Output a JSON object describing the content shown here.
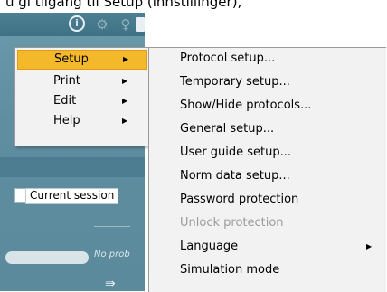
{
  "caption_text": "u gi tilgang til Setup (innstillinger),",
  "toolbar": {
    "info_icon": "info-icon",
    "gear_icon": "gear-icon",
    "bulb_icon": "bulb-icon",
    "exit_icon": "exit-door-icon"
  },
  "session": {
    "label": "Current session"
  },
  "status": {
    "no_prob": "No prob"
  },
  "menu": {
    "items": [
      {
        "label": "Setup",
        "has_submenu": true,
        "highlighted": true
      },
      {
        "label": "Print",
        "has_submenu": true
      },
      {
        "label": "Edit",
        "has_submenu": true
      },
      {
        "label": "Help",
        "has_submenu": true
      }
    ]
  },
  "submenu": {
    "items": [
      {
        "label": "Protocol setup..."
      },
      {
        "label": "Temporary setup..."
      },
      {
        "label": "Show/Hide protocols..."
      },
      {
        "label": "General setup..."
      },
      {
        "label": "User guide setup..."
      },
      {
        "label": "Norm data setup..."
      },
      {
        "label": "Password protection"
      },
      {
        "label": "Unlock protection",
        "disabled": true
      },
      {
        "label": "Language",
        "has_submenu": true
      },
      {
        "label": "Simulation mode"
      }
    ]
  },
  "colors": {
    "highlight": "#f4b92a",
    "panel": "#5e8e9f",
    "menu_bg": "#f2f2f2"
  }
}
